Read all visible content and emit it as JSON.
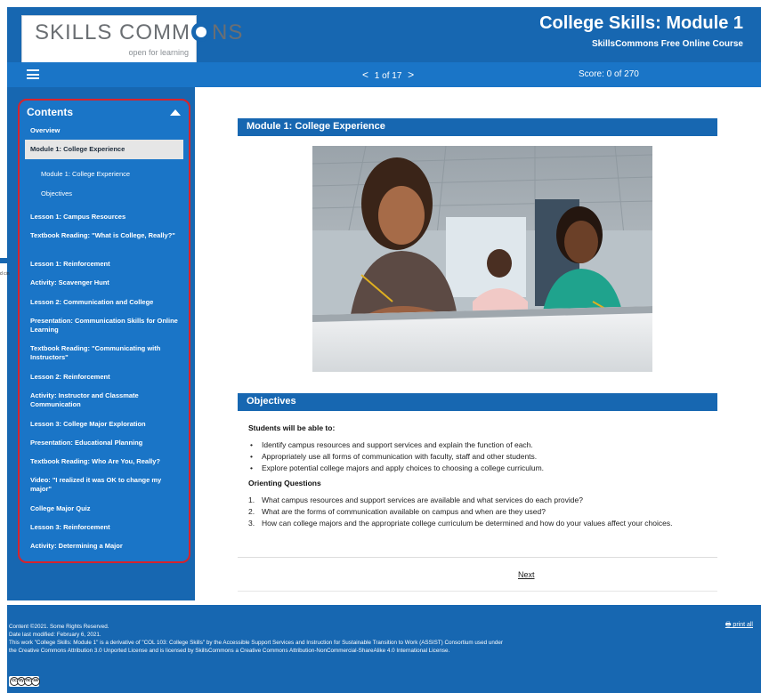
{
  "header": {
    "logo_main_left": "SKILLS COMM",
    "logo_main_right": "NS",
    "logo_sub": "open for learning",
    "course_title": "College Skills: Module 1",
    "course_subtitle": "SkillsCommons Free Online Course"
  },
  "navbar": {
    "prev_glyph": "<",
    "page_indicator": "1 of 17",
    "next_glyph": ">",
    "score": "Score: 0 of 270"
  },
  "sidebar": {
    "heading": "Contents",
    "items": [
      {
        "label": "Overview"
      },
      {
        "label": "Module 1: College Experience"
      },
      {
        "label": "Module 1: College Experience"
      },
      {
        "label": "Objectives"
      },
      {
        "label": "Lesson 1: Campus Resources"
      },
      {
        "label": "Textbook Reading: \"What is College, Really?\""
      },
      {
        "label": "Lesson 1: Reinforcement"
      },
      {
        "label": "Activity: Scavenger Hunt"
      },
      {
        "label": "Lesson 2: Communication and College"
      },
      {
        "label": "Presentation: Communication Skills for Online Learning"
      },
      {
        "label": "Textbook Reading: \"Communicating with Instructors\""
      },
      {
        "label": "Lesson 2: Reinforcement"
      },
      {
        "label": "Activity: Instructor and Classmate Communication"
      },
      {
        "label": "Lesson 3: College Major Exploration"
      },
      {
        "label": "Presentation: Educational Planning"
      },
      {
        "label": "Textbook Reading: Who Are You, Really?"
      },
      {
        "label": "Video: \"I realized it was OK to change my major\""
      },
      {
        "label": "College Major Quiz"
      },
      {
        "label": "Lesson 3: Reinforcement"
      },
      {
        "label": "Activity: Determining a Major"
      }
    ]
  },
  "main": {
    "module_heading": "Module 1: College Experience",
    "objectives_heading": "Objectives",
    "students_heading": "Students will be able to:",
    "bullets": [
      "Identify campus resources and support services and explain the function of each.",
      "Appropriately use all forms of communication with faculty, staff and other students.",
      "Explore potential college majors and apply choices to choosing a college curriculum."
    ],
    "questions_heading": "Orienting Questions",
    "questions": [
      "What campus resources and support services are available and what services do each provide?",
      "What are the forms of communication available on campus and when are they used?",
      "How can college majors and the appropriate college curriculum be determined and how do your values affect your choices."
    ],
    "next_label": "Next"
  },
  "footer": {
    "line1": "Content ©2021. Some Rights Reserved.",
    "line2": "Date last modified: February 6, 2021.",
    "line3": "This work \"College Skills: Module 1\" is a derivative of \"COL 103: College Skills\" by the Accessible Support Services and Instruction for Sustainable Transition to Work (ASSIST) Consortium used under the Creative Commons Attribution 3.0 Unported License and is licensed by SkillsCommons a Creative Commons Attribution-NonCommercial-ShareAlike 4.0 International License.",
    "print_label": "print all",
    "cc_badge_marks": [
      "cc",
      "by",
      "nc",
      "sa"
    ]
  },
  "edge_fragment": "d cin",
  "colors": {
    "header_blue": "#1767b1",
    "nav_blue": "#1a75c7",
    "highlight_red": "#d7232c",
    "active_item_bg": "#e6e6e6"
  }
}
